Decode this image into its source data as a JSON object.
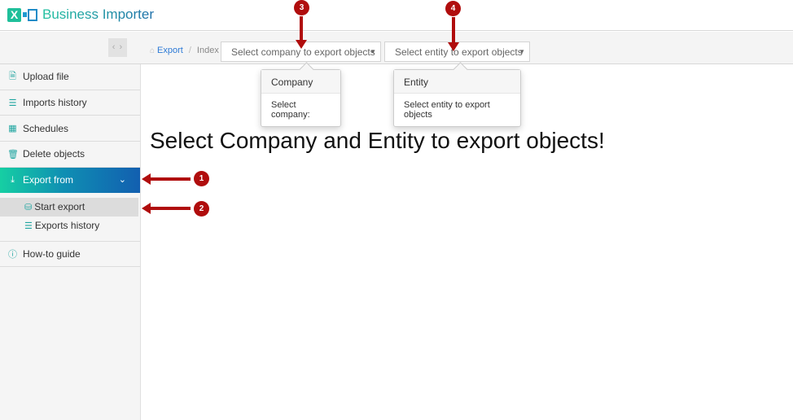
{
  "app": {
    "title": "Business Importer",
    "logo_icon": "excel-import-icon"
  },
  "subbar": {
    "collapse_label": "‹ ›",
    "breadcrumb": {
      "home_icon": "home-icon",
      "link": "Export",
      "separator": "/",
      "current": "Index"
    },
    "company_select": {
      "value": "Select company to export objects",
      "caret": "▼"
    },
    "entity_select": {
      "value": "Select entity to export objects",
      "caret": "▼"
    }
  },
  "sidebar": {
    "items": [
      {
        "label": "Upload file",
        "icon": "file-excel-icon",
        "glyph": "🗎"
      },
      {
        "label": "Imports history",
        "icon": "list-icon",
        "glyph": "☰"
      },
      {
        "label": "Schedules",
        "icon": "calendar-icon",
        "glyph": "▦"
      },
      {
        "label": "Delete objects",
        "icon": "trash-icon",
        "glyph": "🗑"
      },
      {
        "label": "Export from",
        "icon": "download-icon",
        "glyph": "⤓",
        "chevron": "⌄",
        "active": true
      },
      {
        "label": "How-to guide",
        "icon": "info-icon",
        "glyph": "ⓘ"
      }
    ],
    "export_sub": [
      {
        "label": "Start export",
        "icon": "database-icon",
        "glyph": "⛁",
        "selected": true
      },
      {
        "label": "Exports history",
        "icon": "list-icon",
        "glyph": "☰"
      }
    ]
  },
  "popovers": {
    "company": {
      "title": "Company",
      "body": "Select company:"
    },
    "entity": {
      "title": "Entity",
      "body": "Select entity to export objects"
    }
  },
  "main": {
    "heading": "Select Company and Entity to export objects!"
  },
  "annotations": {
    "m1": "1",
    "m2": "2",
    "m3": "3",
    "m4": "4",
    "color": "#b00d0d"
  }
}
